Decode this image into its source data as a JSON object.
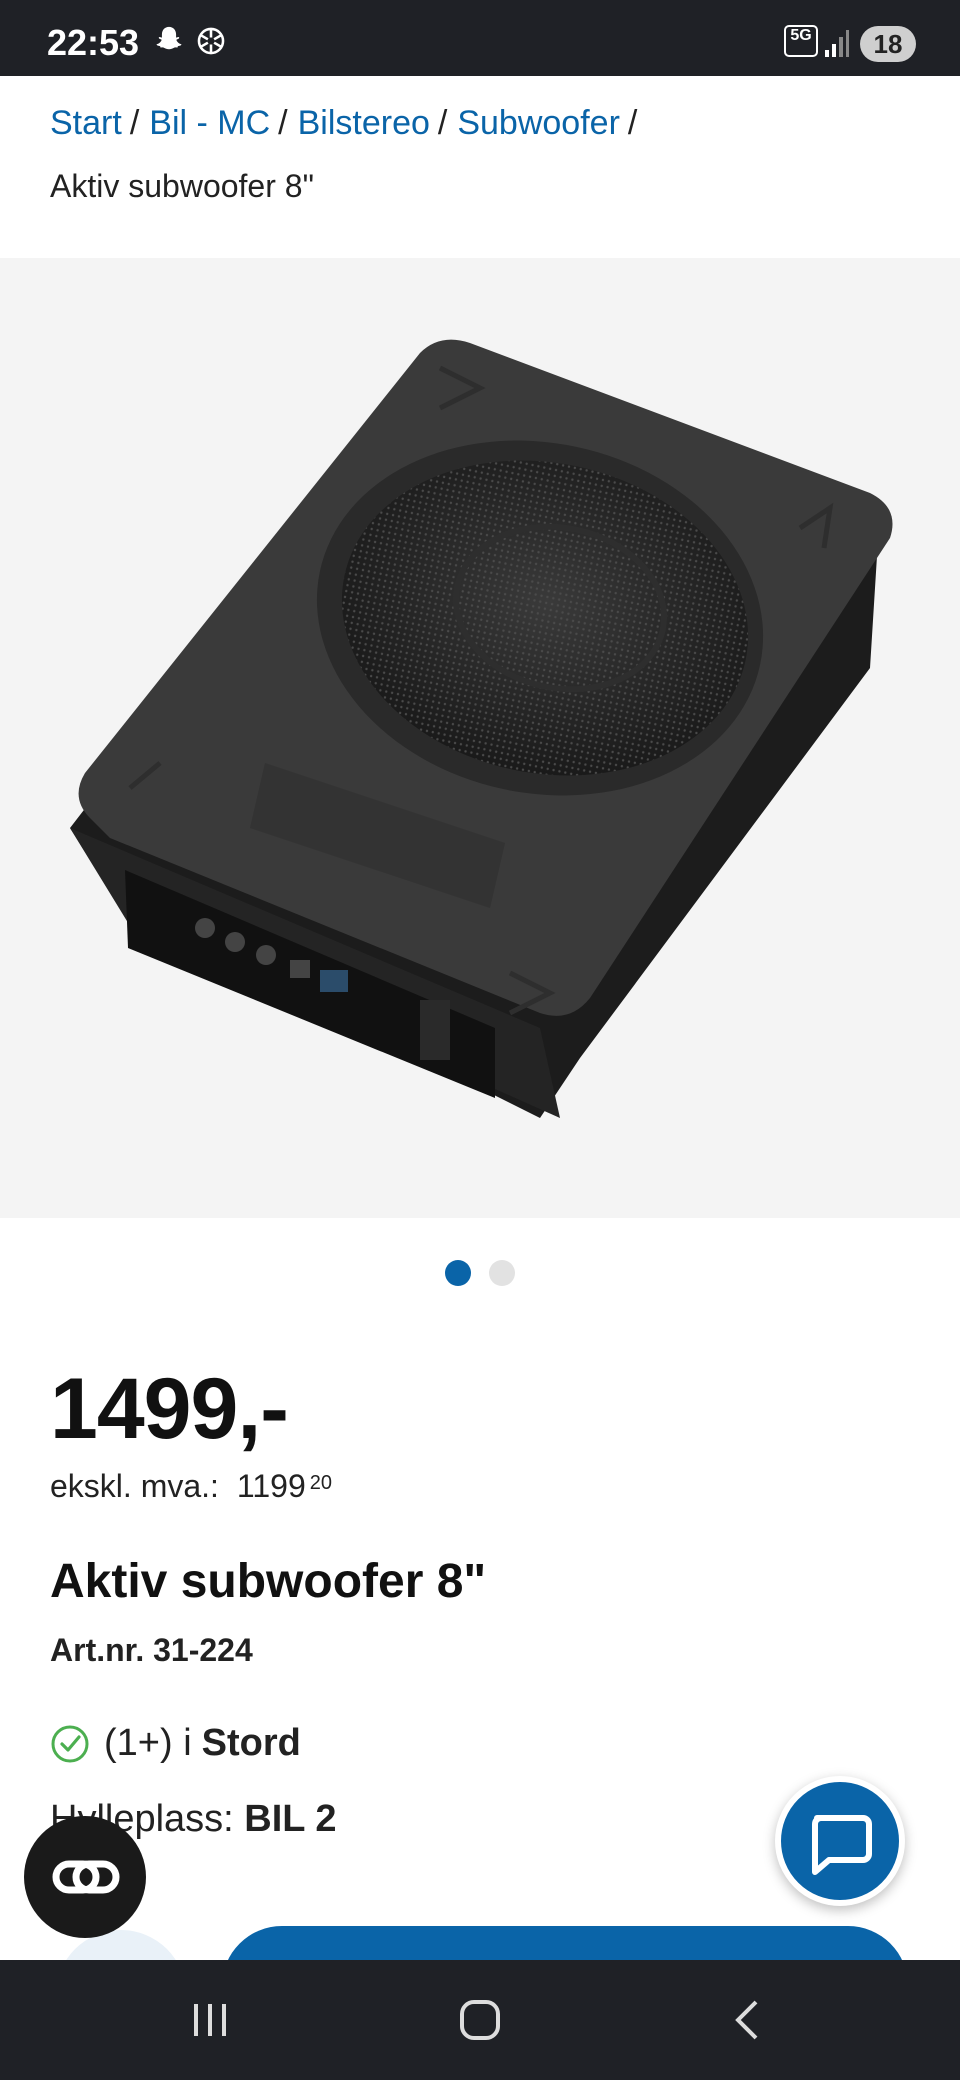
{
  "status_bar": {
    "time": "22:53",
    "icons": [
      "snapchat-icon",
      "openai-icon"
    ],
    "network_badge": "5G",
    "battery": "18"
  },
  "breadcrumb": {
    "items": [
      "Start",
      "Bil - MC",
      "Bilstereo",
      "Subwoofer"
    ],
    "separator": "/",
    "current": "Aktiv subwoofer 8\""
  },
  "gallery": {
    "image": "subwoofer-product-photo",
    "dots_total": 2,
    "active_dot": 1
  },
  "product": {
    "price": "1499,-",
    "ex_vat_label": "ekskl. mva.:",
    "ex_vat_amount": "1199",
    "ex_vat_cents": "20",
    "title": "Aktiv subwoofer 8\"",
    "art_nr": "Art.nr. 31-224",
    "stock_count": "(1+) i",
    "stock_store": "Stord",
    "shelf_label": "Hylleplass:",
    "shelf_value": "BIL 2"
  },
  "colors": {
    "accent": "#0a64a8",
    "check": "#4caf50",
    "bars": "#1f2126"
  }
}
